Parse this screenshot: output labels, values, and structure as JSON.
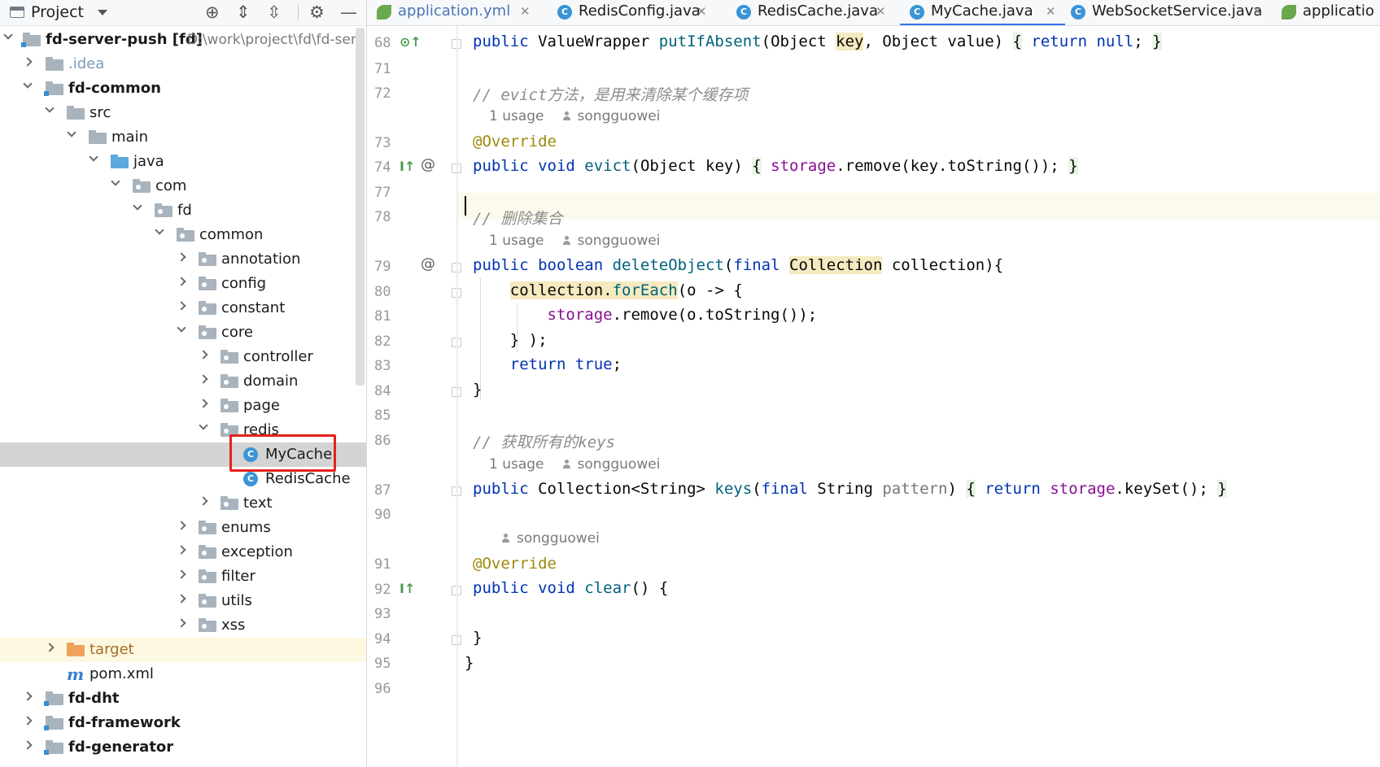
{
  "project_panel": {
    "title": "Project",
    "root_label": "fd-server-push [fd]",
    "root_path": "D:\\work\\project\\fd\\fd-ser",
    "items": [
      {
        "label": "fd-server-push [fd]"
      },
      {
        "label": ".idea"
      },
      {
        "label": "fd-common"
      },
      {
        "label": "src"
      },
      {
        "label": "main"
      },
      {
        "label": "java"
      },
      {
        "label": "com"
      },
      {
        "label": "fd"
      },
      {
        "label": "common"
      },
      {
        "label": "annotation"
      },
      {
        "label": "config"
      },
      {
        "label": "constant"
      },
      {
        "label": "core"
      },
      {
        "label": "controller"
      },
      {
        "label": "domain"
      },
      {
        "label": "page"
      },
      {
        "label": "redis"
      },
      {
        "label": "MyCache"
      },
      {
        "label": "RedisCache"
      },
      {
        "label": "text"
      },
      {
        "label": "enums"
      },
      {
        "label": "exception"
      },
      {
        "label": "filter"
      },
      {
        "label": "utils"
      },
      {
        "label": "xss"
      },
      {
        "label": "target"
      },
      {
        "label": "pom.xml"
      },
      {
        "label": "fd-dht"
      },
      {
        "label": "fd-framework"
      },
      {
        "label": "fd-generator"
      }
    ]
  },
  "tabs": [
    {
      "label": "application.yml",
      "icon": "spring-leaf-icon"
    },
    {
      "label": "RedisConfig.java",
      "icon": "class-icon"
    },
    {
      "label": "RedisCache.java",
      "icon": "class-icon"
    },
    {
      "label": "MyCache.java",
      "icon": "class-icon",
      "active": true
    },
    {
      "label": "WebSocketService.java",
      "icon": "class-icon"
    },
    {
      "label": "applicatio",
      "icon": "spring-leaf-icon"
    }
  ],
  "editor": {
    "file": "MyCache.java",
    "line_numbers": [
      "68",
      "71",
      "72",
      "73",
      "74",
      "77",
      "78",
      "79",
      "80",
      "81",
      "82",
      "83",
      "84",
      "85",
      "86",
      "87",
      "90",
      "91",
      "92",
      "93",
      "94",
      "95",
      "96"
    ],
    "comments": {
      "evict": "// evict方法，是用来清除某个缓存项",
      "delete": "// 删除集合",
      "keys": "// 获取所有的keys"
    },
    "inlay": {
      "usage": "1 usage",
      "author": "songguowei"
    },
    "colors": {
      "keyword": "#0033b3",
      "function": "#00627a",
      "field": "#871094",
      "annotation": "#9e880d",
      "comment": "#8c8c8c"
    }
  }
}
